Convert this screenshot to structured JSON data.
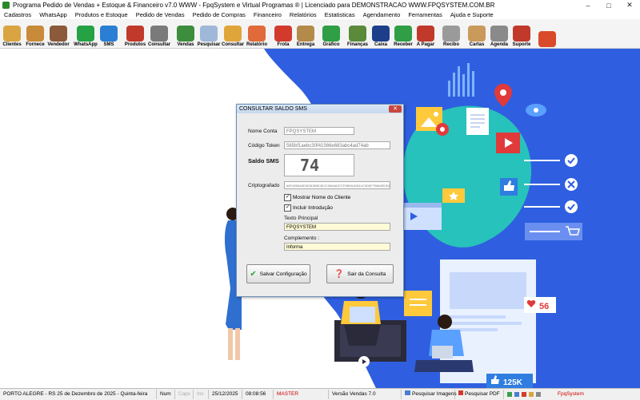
{
  "window": {
    "title": "Programa Pedido de Vendas + Estoque & Financeiro v7.0 WWW - FpqSystem e Virtual Programas ® | Licenciado para  DEMONSTRACAO WWW.FPQSYSTEM.COM.BR",
    "minimize": "–",
    "maximize": "□",
    "close": "✕"
  },
  "menu": [
    "Cadastros",
    "WhatsApp",
    "Produtos e Estoque",
    "Pedido de Vendas",
    "Pedido de Compras",
    "Financeiro",
    "Relatórios",
    "Estatisticas",
    "Agendamento",
    "Ferramentas",
    "Ajuda e Suporte"
  ],
  "toolbar": [
    {
      "label": "Clientes",
      "icon": "clients-icon",
      "color": "#d9a441"
    },
    {
      "label": "Fornece",
      "icon": "supplier-icon",
      "color": "#c98a3a"
    },
    {
      "label": "Vendedor",
      "icon": "seller-icon",
      "color": "#8a5a3a"
    },
    {
      "label": "WhatsApp",
      "icon": "whatsapp-icon",
      "color": "#25a244"
    },
    {
      "label": "SMS",
      "icon": "sms-icon",
      "color": "#2a7fd4"
    },
    {
      "label": "Produtos",
      "icon": "products-icon",
      "color": "#c0392b"
    },
    {
      "label": "Consultar",
      "icon": "consult-icon",
      "color": "#7a7a7a"
    },
    {
      "label": "Vendas",
      "icon": "sales-cart-icon",
      "color": "#3c8d3c"
    },
    {
      "label": "Pesquisar",
      "icon": "search-doc-icon",
      "color": "#9fb7d8"
    },
    {
      "label": "Consultar",
      "icon": "folder-icon",
      "color": "#e0a53a"
    },
    {
      "label": "Relatório",
      "icon": "report-icon",
      "color": "#e06a3a"
    },
    {
      "label": "Frota",
      "icon": "truck-icon",
      "color": "#d23b2b"
    },
    {
      "label": "Entrega",
      "icon": "delivery-icon",
      "color": "#b48a4a"
    },
    {
      "label": "Gráfico",
      "icon": "chart-icon",
      "color": "#2f9e44"
    },
    {
      "label": "Finanças",
      "icon": "finance-icon",
      "color": "#5a8a3a"
    },
    {
      "label": "Caixa",
      "icon": "cashier-icon",
      "color": "#1d3f8a"
    },
    {
      "label": "Receber",
      "icon": "receive-money-icon",
      "color": "#2f9e44"
    },
    {
      "label": "A Pagar",
      "icon": "pay-money-icon",
      "color": "#c0392b"
    },
    {
      "label": "Recibo",
      "icon": "receipt-icon",
      "color": "#9a9a9a"
    },
    {
      "label": "Cartas",
      "icon": "letters-icon",
      "color": "#c99a5a"
    },
    {
      "label": "Agenda",
      "icon": "agenda-icon",
      "color": "#8a8a8a"
    },
    {
      "label": "Suporte",
      "icon": "support-icon",
      "color": "#c0392b"
    },
    {
      "label": "",
      "icon": "exit-icon",
      "color": "#d94a2a"
    }
  ],
  "dialog": {
    "title": "CONSULTAR SALDO SMS",
    "close": "✕",
    "nome_conta_label": "Nome  Conta",
    "nome_conta_value": "FPQSYSTEM",
    "codigo_token_label": "Código Token",
    "codigo_token_value": "565bf1aebc30f41566e683abc4ad74ab",
    "saldo_label": "Saldo SMS",
    "saldo_value": "74",
    "criptografado_label": "Criptografado",
    "criptografado_value": "66F42B6A0E6D5D5BE4E2C96A6A57CF6B9A1E8A1C5D6F7B8A9E0D1C2B3A4F5E6D7C8B9A0F1E2D3C4B5",
    "chk_mostrar": "Mostrar Nome do Cliente",
    "chk_incluir": "Incluir Introdução",
    "texto_principal_label": "Texto Principal",
    "texto_principal_value": "FPQSYSTEM",
    "complemento_label": "Complemento :",
    "complemento_value": "Informa",
    "btn_salvar": "Salvar Configuração",
    "btn_sair": "Sair da Consulta"
  },
  "illustration": {
    "likes": "56",
    "followers": "125K"
  },
  "status": {
    "location": "PORTO ALEGRE - RS 25 de Dezembro de 2025 - Quinta-feira",
    "num": "Num",
    "caps": "Caps",
    "ins": "Ins",
    "date": "25/12/2025",
    "time": "08:08:56",
    "user": "MASTER",
    "version": "Versão Vendas 7.0",
    "search_images": "Pesquisar Imagens",
    "search_pdf": "Pesquisar PDF",
    "brand": "FpqSystem"
  },
  "colors": {
    "blob": "#2f5fe0",
    "accent_red": "#cc0000",
    "dialog_title": "#c6d8ee"
  }
}
